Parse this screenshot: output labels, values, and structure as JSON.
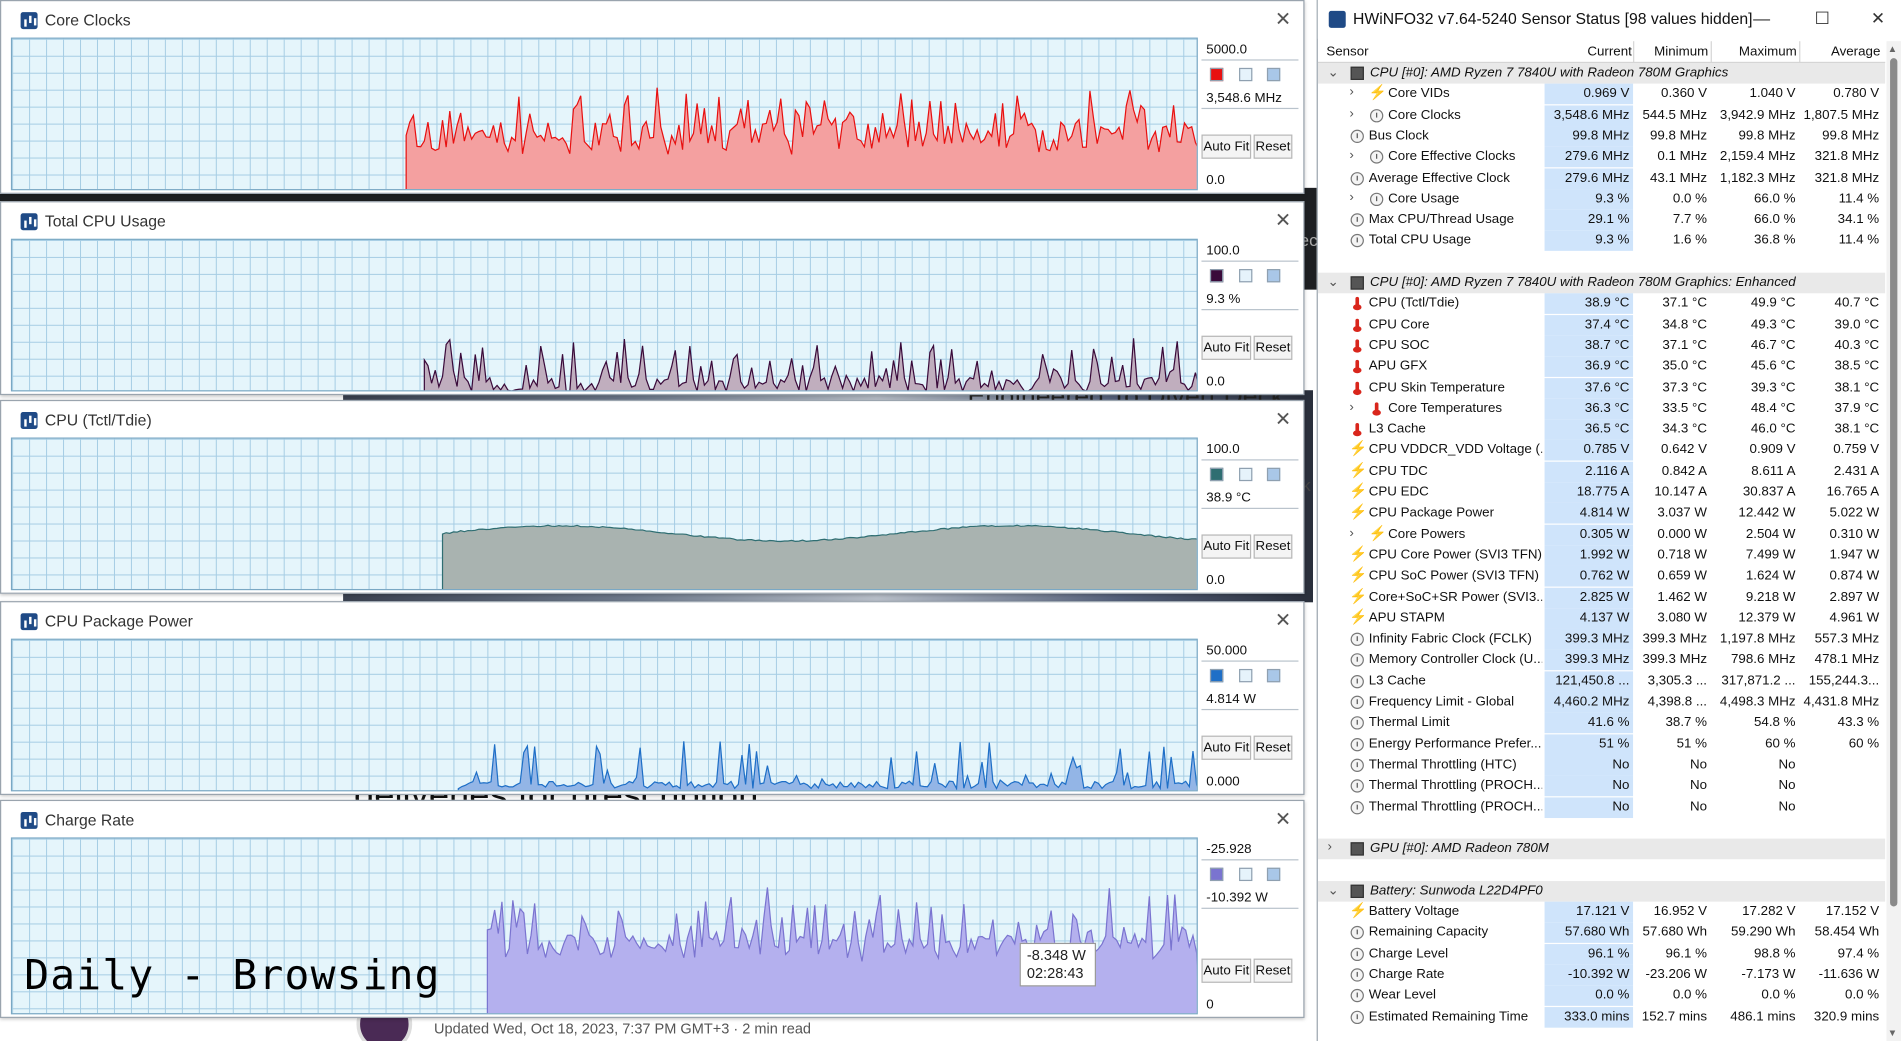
{
  "background": {
    "headline_fragment": "Engineered To Divert Deck",
    "subhead_fragment": "deliveries for prescription",
    "side_fragment_1": "ec",
    "side_fragment_2": "k",
    "footer": "Updated Wed, Oct 18, 2023, 7:37 PM GMT+3 · 2 min read"
  },
  "overlay_label": "Daily - Browsing",
  "tooltip": {
    "value": "-8.348 W",
    "time": "02:28:43"
  },
  "graphs": [
    {
      "title": "Core Clocks",
      "max": "5000.0",
      "current": "3,548.6 MHz",
      "min": "0.0",
      "color": "#e81010",
      "fill": "#f4a0a0",
      "autofit": "Auto Fit",
      "reset": "Reset"
    },
    {
      "title": "Total CPU Usage",
      "max": "100.0",
      "current": "9.3 %",
      "min": "0.0",
      "color": "#3a0a3a",
      "fill": "#c0aebe",
      "autofit": "Auto Fit",
      "reset": "Reset"
    },
    {
      "title": "CPU (Tctl/Tdie)",
      "max": "100.0",
      "current": "38.9 °C",
      "min": "0.0",
      "color": "#2f6e72",
      "fill": "#a9b3b0",
      "autofit": "Auto Fit",
      "reset": "Reset"
    },
    {
      "title": "CPU Package Power",
      "max": "50.000",
      "current": "4.814 W",
      "min": "0.000",
      "color": "#1e6fc7",
      "fill": "#93b5e6",
      "autofit": "Auto Fit",
      "reset": "Reset"
    },
    {
      "title": "Charge Rate",
      "max": "-25.928",
      "current": "-10.392 W",
      "min": "0",
      "color": "#7a74d0",
      "fill": "#b4b0ee",
      "autofit": "Auto Fit",
      "reset": "Reset"
    }
  ],
  "hw": {
    "title": "HWiNFO32 v7.64-5240 Sensor Status [98 values hidden]",
    "minimize": "—",
    "maximize": "☐",
    "close": "✕",
    "headers": {
      "sensor": "Sensor",
      "current": "Current",
      "minimum": "Minimum",
      "maximum": "Maximum",
      "average": "Average"
    },
    "rows": [
      {
        "type": "group",
        "exp": "⌄",
        "icon": "chip",
        "label": "CPU [#0]: AMD Ryzen 7 7840U with Radeon 780M Graphics"
      },
      {
        "type": "item",
        "exp": "›",
        "indent": 1,
        "icon": "volt",
        "label": "Core VIDs",
        "cur": "0.969 V",
        "min": "0.360 V",
        "max": "1.040 V",
        "avg": "0.780 V"
      },
      {
        "type": "item",
        "exp": "›",
        "indent": 1,
        "icon": "clock",
        "label": "Core Clocks",
        "cur": "3,548.6 MHz",
        "min": "544.5 MHz",
        "max": "3,942.9 MHz",
        "avg": "1,807.5 MHz"
      },
      {
        "type": "item",
        "indent": 0,
        "icon": "clock",
        "label": "Bus Clock",
        "cur": "99.8 MHz",
        "min": "99.8 MHz",
        "max": "99.8 MHz",
        "avg": "99.8 MHz"
      },
      {
        "type": "item",
        "exp": "›",
        "indent": 1,
        "icon": "clock",
        "label": "Core Effective Clocks",
        "cur": "279.6 MHz",
        "min": "0.1 MHz",
        "max": "2,159.4 MHz",
        "avg": "321.8 MHz"
      },
      {
        "type": "item",
        "indent": 0,
        "icon": "clock",
        "label": "Average Effective Clock",
        "cur": "279.6 MHz",
        "min": "43.1 MHz",
        "max": "1,182.3 MHz",
        "avg": "321.8 MHz"
      },
      {
        "type": "item",
        "exp": "›",
        "indent": 1,
        "icon": "clock",
        "label": "Core Usage",
        "cur": "9.3 %",
        "min": "0.0 %",
        "max": "66.0 %",
        "avg": "11.4 %"
      },
      {
        "type": "item",
        "indent": 0,
        "icon": "clock",
        "label": "Max CPU/Thread Usage",
        "cur": "29.1 %",
        "min": "7.7 %",
        "max": "66.0 %",
        "avg": "34.1 %"
      },
      {
        "type": "item",
        "indent": 0,
        "icon": "clock",
        "label": "Total CPU Usage",
        "cur": "9.3 %",
        "min": "1.6 %",
        "max": "36.8 %",
        "avg": "11.4 %"
      },
      {
        "type": "spacer"
      },
      {
        "type": "group",
        "exp": "⌄",
        "icon": "chip",
        "label": "CPU [#0]: AMD Ryzen 7 7840U with Radeon 780M Graphics: Enhanced"
      },
      {
        "type": "item",
        "indent": 0,
        "icon": "temp",
        "label": "CPU (Tctl/Tdie)",
        "cur": "38.9 °C",
        "min": "37.1 °C",
        "max": "49.9 °C",
        "avg": "40.7 °C"
      },
      {
        "type": "item",
        "indent": 0,
        "icon": "temp",
        "label": "CPU Core",
        "cur": "37.4 °C",
        "min": "34.8 °C",
        "max": "49.3 °C",
        "avg": "39.0 °C"
      },
      {
        "type": "item",
        "indent": 0,
        "icon": "temp",
        "label": "CPU SOC",
        "cur": "38.7 °C",
        "min": "37.1 °C",
        "max": "46.7 °C",
        "avg": "40.3 °C"
      },
      {
        "type": "item",
        "indent": 0,
        "icon": "temp",
        "label": "APU GFX",
        "cur": "36.9 °C",
        "min": "35.0 °C",
        "max": "45.6 °C",
        "avg": "38.5 °C"
      },
      {
        "type": "item",
        "indent": 0,
        "icon": "temp",
        "label": "CPU Skin Temperature",
        "cur": "37.6 °C",
        "min": "37.3 °C",
        "max": "39.3 °C",
        "avg": "38.1 °C"
      },
      {
        "type": "item",
        "exp": "›",
        "indent": 1,
        "icon": "temp",
        "label": "Core Temperatures",
        "cur": "36.3 °C",
        "min": "33.5 °C",
        "max": "48.4 °C",
        "avg": "37.9 °C"
      },
      {
        "type": "item",
        "indent": 0,
        "icon": "temp",
        "label": "L3 Cache",
        "cur": "36.5 °C",
        "min": "34.3 °C",
        "max": "46.0 °C",
        "avg": "38.1 °C"
      },
      {
        "type": "item",
        "indent": 0,
        "icon": "volt",
        "label": "CPU VDDCR_VDD Voltage (...",
        "cur": "0.785 V",
        "min": "0.642 V",
        "max": "0.909 V",
        "avg": "0.759 V"
      },
      {
        "type": "item",
        "indent": 0,
        "icon": "volt",
        "label": "CPU TDC",
        "cur": "2.116 A",
        "min": "0.842 A",
        "max": "8.611 A",
        "avg": "2.431 A"
      },
      {
        "type": "item",
        "indent": 0,
        "icon": "volt",
        "label": "CPU EDC",
        "cur": "18.775 A",
        "min": "10.147 A",
        "max": "30.837 A",
        "avg": "16.765 A"
      },
      {
        "type": "item",
        "indent": 0,
        "icon": "volt",
        "label": "CPU Package Power",
        "cur": "4.814 W",
        "min": "3.037 W",
        "max": "12.442 W",
        "avg": "5.022 W"
      },
      {
        "type": "item",
        "exp": "›",
        "indent": 1,
        "icon": "volt",
        "label": "Core Powers",
        "cur": "0.305 W",
        "min": "0.000 W",
        "max": "2.504 W",
        "avg": "0.310 W"
      },
      {
        "type": "item",
        "indent": 0,
        "icon": "volt",
        "label": "CPU Core Power (SVI3 TFN)",
        "cur": "1.992 W",
        "min": "0.718 W",
        "max": "7.499 W",
        "avg": "1.947 W"
      },
      {
        "type": "item",
        "indent": 0,
        "icon": "volt",
        "label": "CPU SoC Power (SVI3 TFN)",
        "cur": "0.762 W",
        "min": "0.659 W",
        "max": "1.624 W",
        "avg": "0.874 W"
      },
      {
        "type": "item",
        "indent": 0,
        "icon": "volt",
        "label": "Core+SoC+SR Power (SVI3...",
        "cur": "2.825 W",
        "min": "1.462 W",
        "max": "9.218 W",
        "avg": "2.897 W"
      },
      {
        "type": "item",
        "indent": 0,
        "icon": "volt",
        "label": "APU STAPM",
        "cur": "4.137 W",
        "min": "3.080 W",
        "max": "12.379 W",
        "avg": "4.961 W"
      },
      {
        "type": "item",
        "indent": 0,
        "icon": "clock",
        "label": "Infinity Fabric Clock (FCLK)",
        "cur": "399.3 MHz",
        "min": "399.3 MHz",
        "max": "1,197.8 MHz",
        "avg": "557.3 MHz"
      },
      {
        "type": "item",
        "indent": 0,
        "icon": "clock",
        "label": "Memory Controller Clock (U...",
        "cur": "399.3 MHz",
        "min": "399.3 MHz",
        "max": "798.6 MHz",
        "avg": "478.1 MHz"
      },
      {
        "type": "item",
        "indent": 0,
        "icon": "clock",
        "label": "L3 Cache",
        "cur": "121,450.8 ...",
        "min": "3,305.3 ...",
        "max": "317,871.2 ...",
        "avg": "155,244.3..."
      },
      {
        "type": "item",
        "indent": 0,
        "icon": "clock",
        "label": "Frequency Limit - Global",
        "cur": "4,460.2 MHz",
        "min": "4,398.8 ...",
        "max": "4,498.3 MHz",
        "avg": "4,431.8 MHz"
      },
      {
        "type": "item",
        "indent": 0,
        "icon": "clock",
        "label": "Thermal Limit",
        "cur": "41.6 %",
        "min": "38.7 %",
        "max": "54.8 %",
        "avg": "43.3 %"
      },
      {
        "type": "item",
        "indent": 0,
        "icon": "clock",
        "label": "Energy Performance Prefer...",
        "cur": "51 %",
        "min": "51 %",
        "max": "60 %",
        "avg": "60 %"
      },
      {
        "type": "item",
        "indent": 0,
        "icon": "clock",
        "label": "Thermal Throttling (HTC)",
        "cur": "No",
        "min": "No",
        "max": "No",
        "avg": ""
      },
      {
        "type": "item",
        "indent": 0,
        "icon": "clock",
        "label": "Thermal Throttling (PROCH...",
        "cur": "No",
        "min": "No",
        "max": "No",
        "avg": ""
      },
      {
        "type": "item",
        "indent": 0,
        "icon": "clock",
        "label": "Thermal Throttling (PROCH...",
        "cur": "No",
        "min": "No",
        "max": "No",
        "avg": ""
      },
      {
        "type": "spacer"
      },
      {
        "type": "group",
        "exp": "›",
        "icon": "chip",
        "label": "GPU [#0]: AMD Radeon 780M"
      },
      {
        "type": "spacer"
      },
      {
        "type": "group",
        "exp": "⌄",
        "icon": "chip",
        "label": "Battery: Sunwoda L22D4PF0"
      },
      {
        "type": "item",
        "indent": 0,
        "icon": "volt",
        "label": "Battery Voltage",
        "cur": "17.121 V",
        "min": "16.952 V",
        "max": "17.282 V",
        "avg": "17.152 V"
      },
      {
        "type": "item",
        "indent": 0,
        "icon": "clock",
        "label": "Remaining Capacity",
        "cur": "57.680 Wh",
        "min": "57.680 Wh",
        "max": "59.290 Wh",
        "avg": "58.454 Wh"
      },
      {
        "type": "item",
        "indent": 0,
        "icon": "clock",
        "label": "Charge Level",
        "cur": "96.1 %",
        "min": "96.1 %",
        "max": "98.8 %",
        "avg": "97.4 %"
      },
      {
        "type": "item",
        "indent": 0,
        "icon": "clock",
        "label": "Charge Rate",
        "cur": "-10.392 W",
        "min": "-23.206 W",
        "max": "-7.173 W",
        "avg": "-11.636 W"
      },
      {
        "type": "item",
        "indent": 0,
        "icon": "clock",
        "label": "Wear Level",
        "cur": "0.0 %",
        "min": "0.0 %",
        "max": "0.0 %",
        "avg": "0.0 %"
      },
      {
        "type": "item",
        "indent": 0,
        "icon": "clock",
        "label": "Estimated Remaining Time",
        "cur": "333.0 mins",
        "min": "152.7 mins",
        "max": "486.1 mins",
        "avg": "320.9 mins"
      }
    ]
  }
}
